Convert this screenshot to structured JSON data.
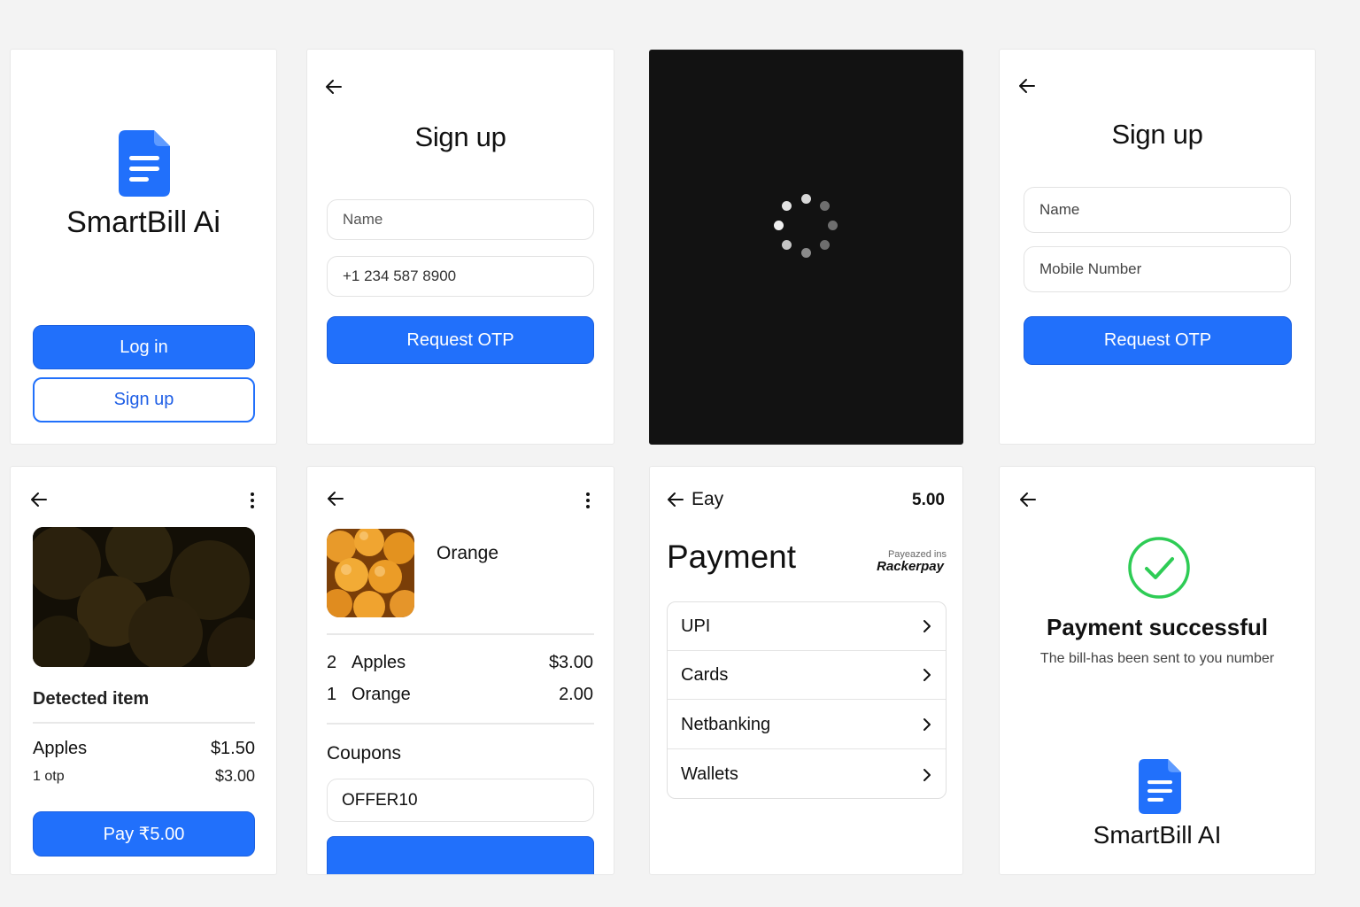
{
  "colors": {
    "accent": "#2170fb",
    "success": "#2ecc55",
    "dark_panel": "#121212"
  },
  "welcome": {
    "logo_icon": "document-icon",
    "app_name": "SmartBill Ai",
    "login_label": "Log in",
    "signup_label": "Sign up"
  },
  "signup_a": {
    "title": "Sign up",
    "name_placeholder": "Name",
    "phone_value": "+1 234 587 8900",
    "otp_label": "Request OTP"
  },
  "loading": {
    "spinner_icon": "loading-spinner-icon"
  },
  "signup_b": {
    "title": "Sign up",
    "name_placeholder": "Name",
    "mobile_placeholder": "Mobile Number",
    "otp_label": "Request OTP"
  },
  "detected": {
    "heading": "Detected item",
    "item_name": "Apples",
    "item_price": "$1.50",
    "sub_label": "1 otp",
    "sub_price": "$3.00",
    "pay_label": "Pay ₹5.00"
  },
  "cart": {
    "product_name": "Orange",
    "items": [
      {
        "qty": "2",
        "name": "Apples",
        "price": "$3.00"
      },
      {
        "qty": "1",
        "name": "Orange",
        "price": "2.00"
      }
    ],
    "coupons_label": "Coupons",
    "coupon_value": "OFFER10"
  },
  "payment": {
    "header_label": "Eay",
    "header_amount": "5.00",
    "title": "Payment",
    "provider_small": "Payeazed ins",
    "provider_name": "Rackerpay",
    "methods": [
      "UPI",
      "Cards",
      "Netbanking",
      "Wallets"
    ]
  },
  "success": {
    "check_icon": "check-circle-icon",
    "title": "Payment successful",
    "message": "The bill-has been sent to you number",
    "app_name": "SmartBill AI"
  }
}
